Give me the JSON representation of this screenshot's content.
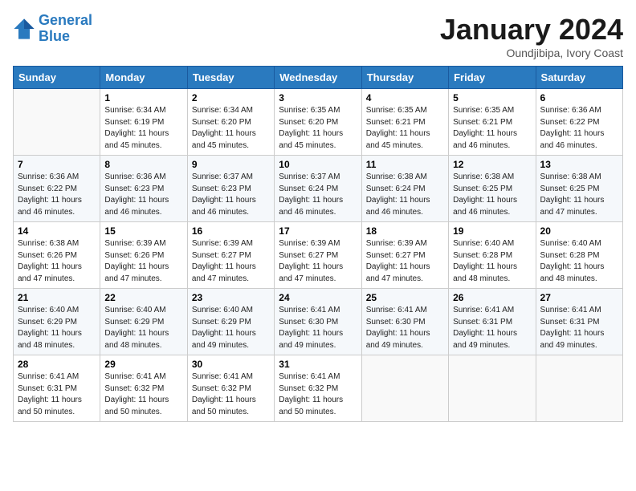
{
  "header": {
    "logo_line1": "General",
    "logo_line2": "Blue",
    "month": "January 2024",
    "location": "Oundjibipa, Ivory Coast"
  },
  "weekdays": [
    "Sunday",
    "Monday",
    "Tuesday",
    "Wednesday",
    "Thursday",
    "Friday",
    "Saturday"
  ],
  "weeks": [
    [
      {
        "day": "",
        "info": ""
      },
      {
        "day": "1",
        "info": "Sunrise: 6:34 AM\nSunset: 6:19 PM\nDaylight: 11 hours\nand 45 minutes."
      },
      {
        "day": "2",
        "info": "Sunrise: 6:34 AM\nSunset: 6:20 PM\nDaylight: 11 hours\nand 45 minutes."
      },
      {
        "day": "3",
        "info": "Sunrise: 6:35 AM\nSunset: 6:20 PM\nDaylight: 11 hours\nand 45 minutes."
      },
      {
        "day": "4",
        "info": "Sunrise: 6:35 AM\nSunset: 6:21 PM\nDaylight: 11 hours\nand 45 minutes."
      },
      {
        "day": "5",
        "info": "Sunrise: 6:35 AM\nSunset: 6:21 PM\nDaylight: 11 hours\nand 46 minutes."
      },
      {
        "day": "6",
        "info": "Sunrise: 6:36 AM\nSunset: 6:22 PM\nDaylight: 11 hours\nand 46 minutes."
      }
    ],
    [
      {
        "day": "7",
        "info": "Sunrise: 6:36 AM\nSunset: 6:22 PM\nDaylight: 11 hours\nand 46 minutes."
      },
      {
        "day": "8",
        "info": "Sunrise: 6:36 AM\nSunset: 6:23 PM\nDaylight: 11 hours\nand 46 minutes."
      },
      {
        "day": "9",
        "info": "Sunrise: 6:37 AM\nSunset: 6:23 PM\nDaylight: 11 hours\nand 46 minutes."
      },
      {
        "day": "10",
        "info": "Sunrise: 6:37 AM\nSunset: 6:24 PM\nDaylight: 11 hours\nand 46 minutes."
      },
      {
        "day": "11",
        "info": "Sunrise: 6:38 AM\nSunset: 6:24 PM\nDaylight: 11 hours\nand 46 minutes."
      },
      {
        "day": "12",
        "info": "Sunrise: 6:38 AM\nSunset: 6:25 PM\nDaylight: 11 hours\nand 46 minutes."
      },
      {
        "day": "13",
        "info": "Sunrise: 6:38 AM\nSunset: 6:25 PM\nDaylight: 11 hours\nand 47 minutes."
      }
    ],
    [
      {
        "day": "14",
        "info": "Sunrise: 6:38 AM\nSunset: 6:26 PM\nDaylight: 11 hours\nand 47 minutes."
      },
      {
        "day": "15",
        "info": "Sunrise: 6:39 AM\nSunset: 6:26 PM\nDaylight: 11 hours\nand 47 minutes."
      },
      {
        "day": "16",
        "info": "Sunrise: 6:39 AM\nSunset: 6:27 PM\nDaylight: 11 hours\nand 47 minutes."
      },
      {
        "day": "17",
        "info": "Sunrise: 6:39 AM\nSunset: 6:27 PM\nDaylight: 11 hours\nand 47 minutes."
      },
      {
        "day": "18",
        "info": "Sunrise: 6:39 AM\nSunset: 6:27 PM\nDaylight: 11 hours\nand 47 minutes."
      },
      {
        "day": "19",
        "info": "Sunrise: 6:40 AM\nSunset: 6:28 PM\nDaylight: 11 hours\nand 48 minutes."
      },
      {
        "day": "20",
        "info": "Sunrise: 6:40 AM\nSunset: 6:28 PM\nDaylight: 11 hours\nand 48 minutes."
      }
    ],
    [
      {
        "day": "21",
        "info": "Sunrise: 6:40 AM\nSunset: 6:29 PM\nDaylight: 11 hours\nand 48 minutes."
      },
      {
        "day": "22",
        "info": "Sunrise: 6:40 AM\nSunset: 6:29 PM\nDaylight: 11 hours\nand 48 minutes."
      },
      {
        "day": "23",
        "info": "Sunrise: 6:40 AM\nSunset: 6:29 PM\nDaylight: 11 hours\nand 49 minutes."
      },
      {
        "day": "24",
        "info": "Sunrise: 6:41 AM\nSunset: 6:30 PM\nDaylight: 11 hours\nand 49 minutes."
      },
      {
        "day": "25",
        "info": "Sunrise: 6:41 AM\nSunset: 6:30 PM\nDaylight: 11 hours\nand 49 minutes."
      },
      {
        "day": "26",
        "info": "Sunrise: 6:41 AM\nSunset: 6:31 PM\nDaylight: 11 hours\nand 49 minutes."
      },
      {
        "day": "27",
        "info": "Sunrise: 6:41 AM\nSunset: 6:31 PM\nDaylight: 11 hours\nand 49 minutes."
      }
    ],
    [
      {
        "day": "28",
        "info": "Sunrise: 6:41 AM\nSunset: 6:31 PM\nDaylight: 11 hours\nand 50 minutes."
      },
      {
        "day": "29",
        "info": "Sunrise: 6:41 AM\nSunset: 6:32 PM\nDaylight: 11 hours\nand 50 minutes."
      },
      {
        "day": "30",
        "info": "Sunrise: 6:41 AM\nSunset: 6:32 PM\nDaylight: 11 hours\nand 50 minutes."
      },
      {
        "day": "31",
        "info": "Sunrise: 6:41 AM\nSunset: 6:32 PM\nDaylight: 11 hours\nand 50 minutes."
      },
      {
        "day": "",
        "info": ""
      },
      {
        "day": "",
        "info": ""
      },
      {
        "day": "",
        "info": ""
      }
    ]
  ]
}
